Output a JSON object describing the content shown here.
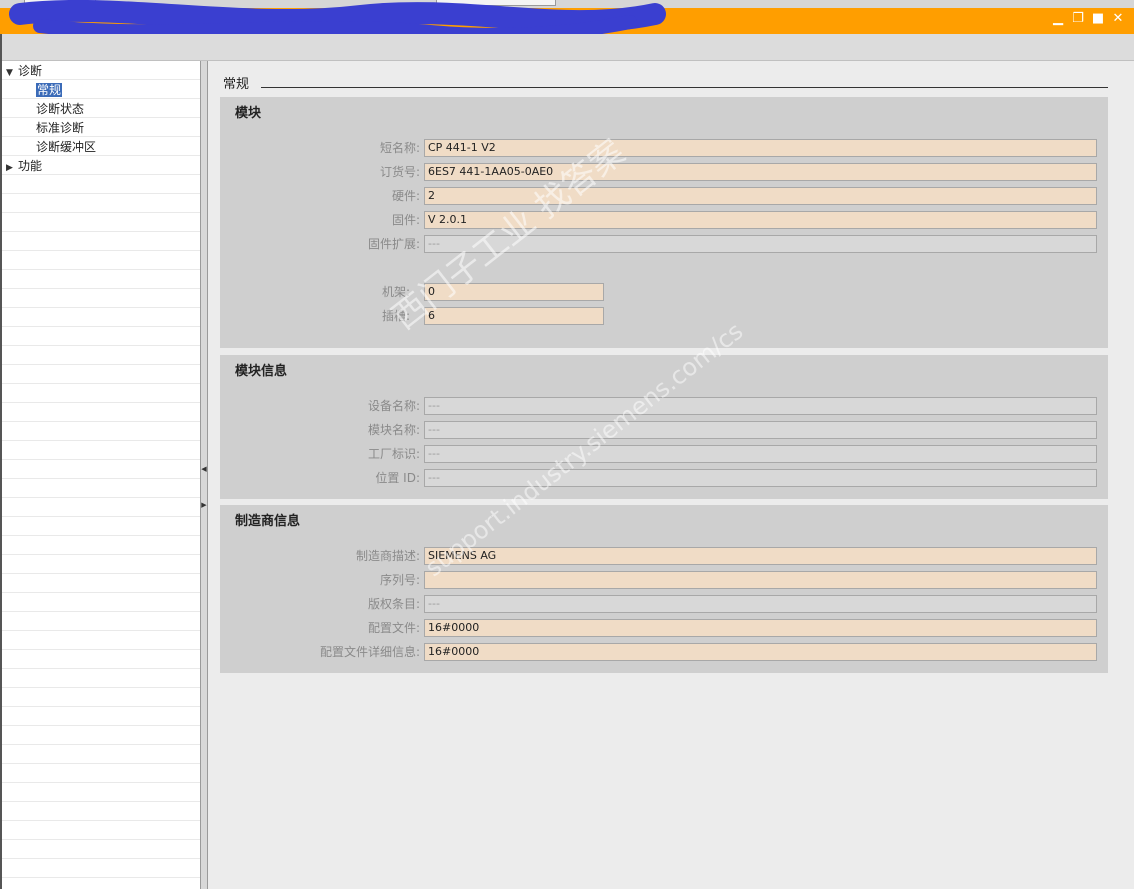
{
  "window": {
    "controls": [
      "▁",
      "❐",
      "■",
      "✕"
    ]
  },
  "tree": {
    "items": [
      {
        "label": "诊断",
        "arrow": "▼",
        "level": 0
      },
      {
        "label": "常规",
        "arrow": "",
        "level": 1,
        "selected": true
      },
      {
        "label": "诊断状态",
        "arrow": "",
        "level": 1
      },
      {
        "label": "标准诊断",
        "arrow": "",
        "level": 1
      },
      {
        "label": "诊断缓冲区",
        "arrow": "",
        "level": 1
      },
      {
        "label": "功能",
        "arrow": "▶",
        "level": 0
      }
    ]
  },
  "main": {
    "title": "常规",
    "sections": [
      {
        "title": "模块",
        "rows": [
          {
            "label": "短名称:",
            "value": "CP 441-1 V2",
            "readonly": false
          },
          {
            "label": "订货号:",
            "value": "6ES7 441-1AA05-0AE0",
            "readonly": false
          },
          {
            "label": "硬件:",
            "value": "2",
            "readonly": false
          },
          {
            "label": "固件:",
            "value": "V 2.0.1",
            "readonly": false
          },
          {
            "label": "固件扩展:",
            "value": "---",
            "readonly": true
          },
          {
            "label": "机架:",
            "value": "0",
            "readonly": false
          },
          {
            "label": "插槽:",
            "value": "6",
            "readonly": false
          }
        ]
      },
      {
        "title": "模块信息",
        "rows": [
          {
            "label": "设备名称:",
            "value": "---",
            "readonly": true
          },
          {
            "label": "模块名称:",
            "value": "---",
            "readonly": true
          },
          {
            "label": "工厂标识:",
            "value": "---",
            "readonly": true
          },
          {
            "label": "位置 ID:",
            "value": "---",
            "readonly": true
          }
        ]
      },
      {
        "title": "制造商信息",
        "rows": [
          {
            "label": "制造商描述:",
            "value": "SIEMENS AG",
            "readonly": false
          },
          {
            "label": "序列号:",
            "value": "",
            "readonly": false
          },
          {
            "label": "版权条目:",
            "value": "---",
            "readonly": true
          },
          {
            "label": "配置文件:",
            "value": "16#0000",
            "readonly": false
          },
          {
            "label": "配置文件详细信息:",
            "value": "16#0000",
            "readonly": false
          }
        ]
      }
    ]
  },
  "watermark": {
    "line1": "西门子工业   找答案",
    "line2": "support.industry.siemens.com/cs"
  }
}
